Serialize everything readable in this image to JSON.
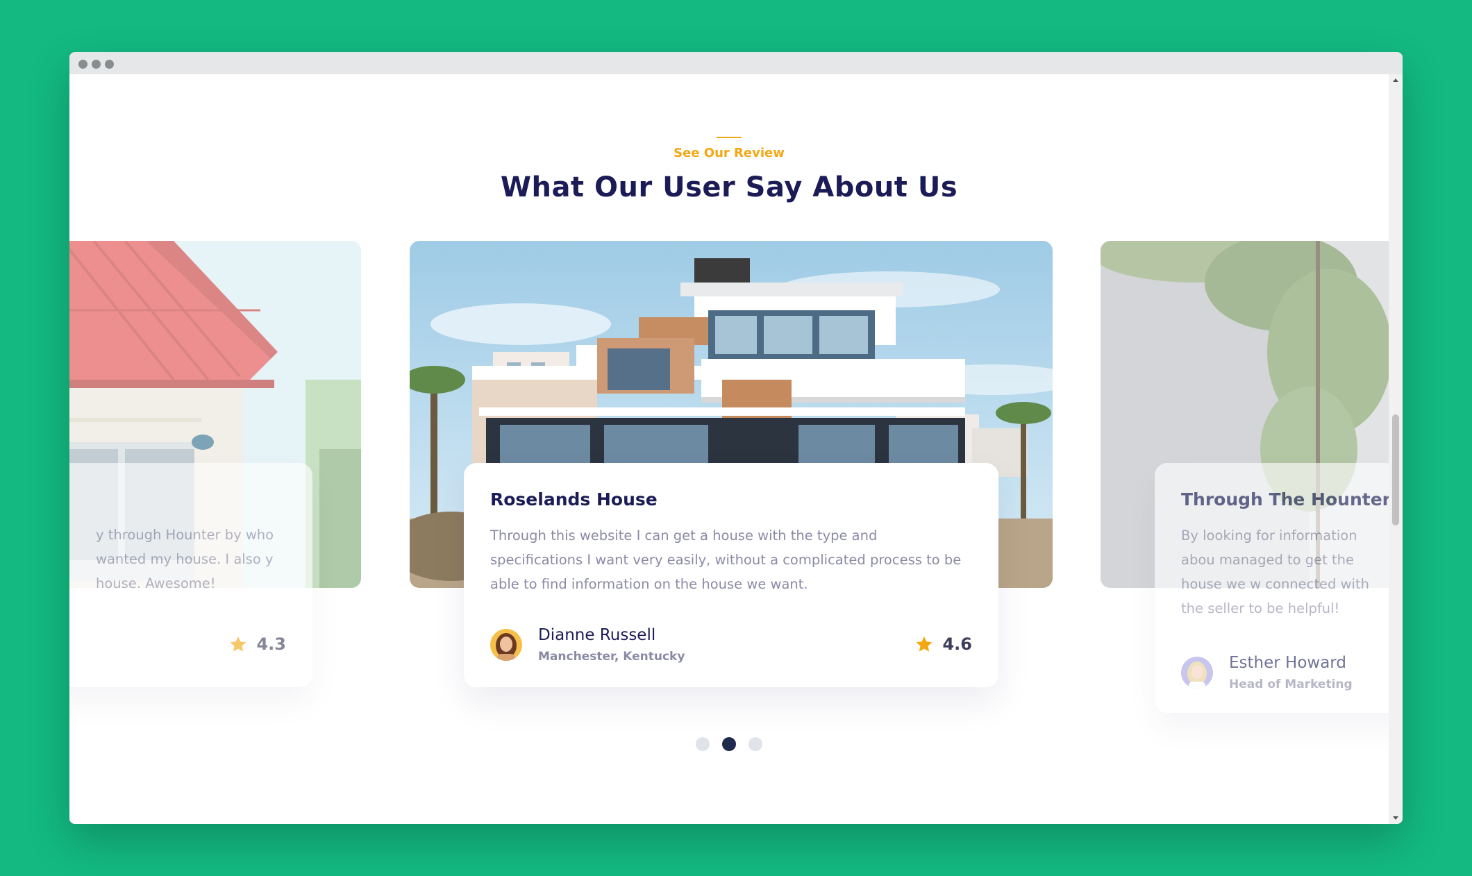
{
  "section": {
    "subtitle": "See Our Review",
    "title": "What Our User Say About Us"
  },
  "reviews": [
    {
      "title": "",
      "text": "y through Hounter by who wanted my house. I also y house. Awesome!",
      "rating": "4.3",
      "state": "partial-left"
    },
    {
      "title": "Roselands House",
      "text": "Through this website I can get a house with the type and specifications I want very easily, without a complicated process to be able to find information on the house we want.",
      "author": "Dianne Russell",
      "role": "Manchester, Kentucky",
      "rating": "4.6",
      "state": "active"
    },
    {
      "title": "Through The Hounter, I c",
      "text": "By looking for information abou managed to get the house we w connected with the seller to be helpful!",
      "author": "Esther Howard",
      "role": "Head of Marketing",
      "state": "partial-right"
    }
  ],
  "pagination": {
    "count": 3,
    "active": 2
  },
  "colors": {
    "background": "#13b981",
    "accent": "#f3a712",
    "heading": "#1b1c57",
    "body_text": "#8a8aa5",
    "active_dot": "#1f2a4f",
    "inactive_dot": "#e1e3ea"
  },
  "icons": {
    "rating": "star-icon",
    "window_controls": "window-dot-icon"
  }
}
